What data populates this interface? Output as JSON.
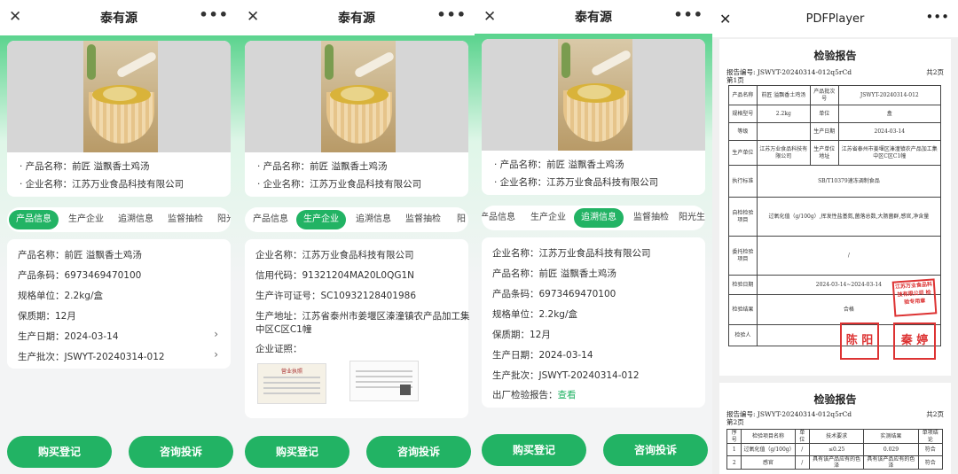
{
  "colors": {
    "accent": "#22b364",
    "header_green": "#2fc870"
  },
  "app": {
    "title": "泰有源",
    "close_icon": "close-icon",
    "more_icon": "more-icon"
  },
  "product": {
    "name_line": "· 产品名称：前匠 溢飘香土鸡汤",
    "company_line": "· 企业名称：江苏万业食品科技有限公司"
  },
  "tabs": {
    "p1": [
      "产品信息",
      "生产企业",
      "追溯信息",
      "监督抽检",
      "阳光"
    ],
    "p2": [
      "产品信息",
      "生产企业",
      "追溯信息",
      "监督抽检",
      "阳"
    ],
    "p3": [
      "产品信息",
      "生产企业",
      "追溯信息",
      "监督抽检",
      "阳光生产"
    ]
  },
  "panel1": {
    "rows": [
      "产品名称：前匠 溢飘香土鸡汤",
      "产品条码：6973469470100",
      "规格单位：2.2kg/盒",
      "保质期：12月",
      "生产日期：2024-03-14",
      "生产批次：JSWYT-20240314-012"
    ]
  },
  "panel2": {
    "rows": [
      "企业名称：江苏万业食品科技有限公司",
      "信用代码：91321204MA20L0QG1N",
      "生产许可证号：SC10932128401986",
      "生产地址：江苏省泰州市姜堰区溱潼镇农产品加工集",
      "中区C区C1幢",
      "企业证照："
    ],
    "license1": "营业执照"
  },
  "panel3": {
    "rows": [
      "企业名称：江苏万业食品科技有限公司",
      "产品名称：前匠 溢飘香土鸡汤",
      "产品条码：6973469470100",
      "规格单位：2.2kg/盒",
      "保质期：12月",
      "生产日期：2024-03-14",
      "生产批次：JSWYT-20240314-012"
    ],
    "report_label": "出厂检验报告：",
    "report_link": "查看"
  },
  "buttons": {
    "buy": "购买登记",
    "consult": "咨询投诉"
  },
  "pdf": {
    "title": "PDFPlayer",
    "report_title": "检验报告",
    "report_no": "报告编号: JSWYT-20240314-012q5rCd",
    "total": "共2页",
    "page1": "第1页",
    "page2": "第2页",
    "table1": [
      [
        "产品名称",
        "前匠 溢飘香土鸡汤",
        "产品批次号",
        "JSWYT-20240314-012"
      ],
      [
        "规格型号",
        "2.2kg",
        "单位",
        "盒"
      ],
      [
        "等级",
        "",
        "生产日期",
        "2024-03-14"
      ],
      [
        "生产单位",
        "江苏万业食品科技有限公司",
        "生产单位地址",
        "江苏省泰州市姜堰区溱潼镇农产品加工集中区C区C1幢"
      ],
      [
        "执行标准",
        "SB/T10379速冻调制食品",
        "",
        ""
      ],
      [
        "自检检验项目",
        "过氧化值（g/100g）,挥发性盐基氮,菌落总数,大肠菌群,感官,净含量",
        "",
        ""
      ],
      [
        "委托检验项目",
        "/",
        "",
        ""
      ],
      [
        "检验日期",
        "2024-03-14~2024-03-14",
        "",
        ""
      ],
      [
        "检验结果",
        "合格",
        "",
        ""
      ],
      [
        "检验人",
        "",
        "",
        ""
      ]
    ],
    "stamp_text": "江苏万业食品科技有限公司 检验专用章",
    "sign1": "陈 阳",
    "sign2": "秦 婷",
    "table2_head": [
      "序号",
      "检验项目名称",
      "单位",
      "技术要求",
      "实测结果",
      "单项结论"
    ],
    "table2_rows": [
      [
        "1",
        "过氧化值（g/100g）",
        "/",
        "≤0.25",
        "0.029",
        "符合"
      ],
      [
        "2",
        "感官",
        "/",
        "具有该产品应有的色泽",
        "具有该产品应有的色泽",
        "符合"
      ]
    ]
  }
}
